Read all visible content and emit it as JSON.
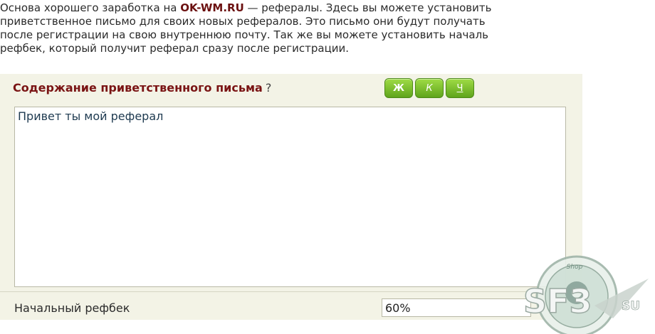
{
  "intro": {
    "line1_before": "Основа хорошего заработка на ",
    "brand": "OK-WM.RU",
    "line1_after": " — рефералы. Здесь вы можете установить",
    "line2": "приветственное письмо для своих новых рефералов. Это письмо они будут получать",
    "line3": "после регистрации на свою внутреннюю почту. Так же вы можете установить началь",
    "line4": "рефбек, который получит реферал сразу после регистрации."
  },
  "welcome": {
    "header": "Содержание приветственного письма",
    "help_mark": "?",
    "format_buttons": {
      "bold": "Ж",
      "italic": "К",
      "underline": "Ч"
    },
    "message": "Привет ты мой реферал"
  },
  "refback": {
    "label": "Начальный рефбек",
    "value": "60%"
  },
  "watermark": {
    "shop": "Shop",
    "logo_text": "SF3",
    "suffix": "SU"
  },
  "colors": {
    "brand": "#6b1010",
    "header": "#7a1414",
    "section_bg": "#f3f3e6",
    "button_green": "#5fa41c"
  }
}
